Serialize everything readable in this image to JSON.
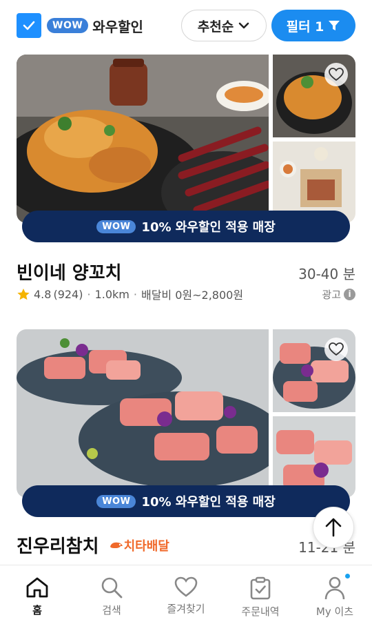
{
  "header": {
    "wow_badge": "WOW",
    "wow_filter_label": "와우할인",
    "sort_label": "추천순",
    "filter_label": "필터 1",
    "accent_color": "#1b8cf0"
  },
  "stores": [
    {
      "banner_badge": "WOW",
      "banner_text": "10% 와우할인 적용 매장",
      "name": "빈이네 양꼬치",
      "eta": "30-40 분",
      "rating": "4.8",
      "reviews": "(924)",
      "distance": "1.0km",
      "delivery_fee": "배달비 0원~2,800원",
      "ad_label": "광고"
    },
    {
      "banner_badge": "WOW",
      "banner_text": "10% 와우할인 적용 매장",
      "name": "진우리참치",
      "cheetah_label": "치타배달",
      "eta": "11-21 분"
    }
  ],
  "nav": [
    {
      "label": "홈",
      "icon": "home-icon",
      "active": true
    },
    {
      "label": "검색",
      "icon": "search-icon"
    },
    {
      "label": "즐겨찾기",
      "icon": "heart-icon"
    },
    {
      "label": "주문내역",
      "icon": "clipboard-icon"
    },
    {
      "label": "My 이츠",
      "icon": "person-icon"
    }
  ]
}
